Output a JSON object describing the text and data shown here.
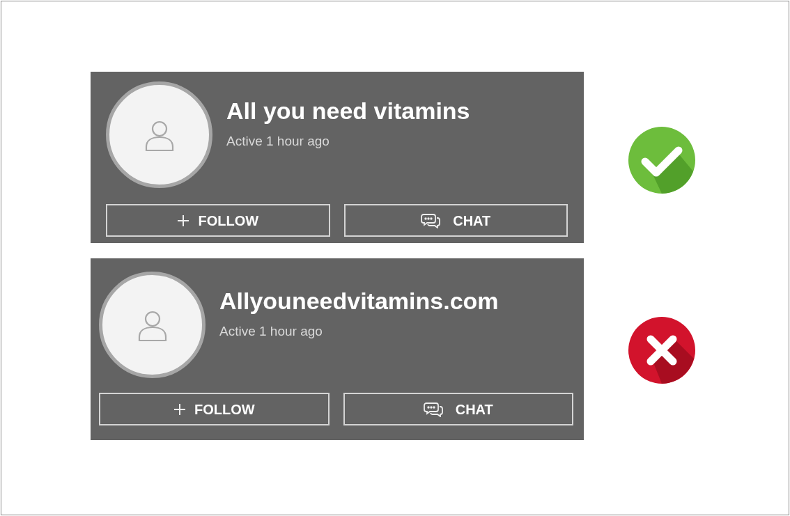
{
  "cards": [
    {
      "name": "All you need vitamins",
      "activity": "Active 1 hour ago",
      "follow": "FOLLOW",
      "chat": "CHAT",
      "verdict": {
        "kind": "check"
      }
    },
    {
      "name": "Allyouneedvitamins.com",
      "activity": "Active 1 hour ago",
      "follow": "FOLLOW",
      "chat": "CHAT",
      "verdict": {
        "kind": "cross"
      }
    }
  ]
}
